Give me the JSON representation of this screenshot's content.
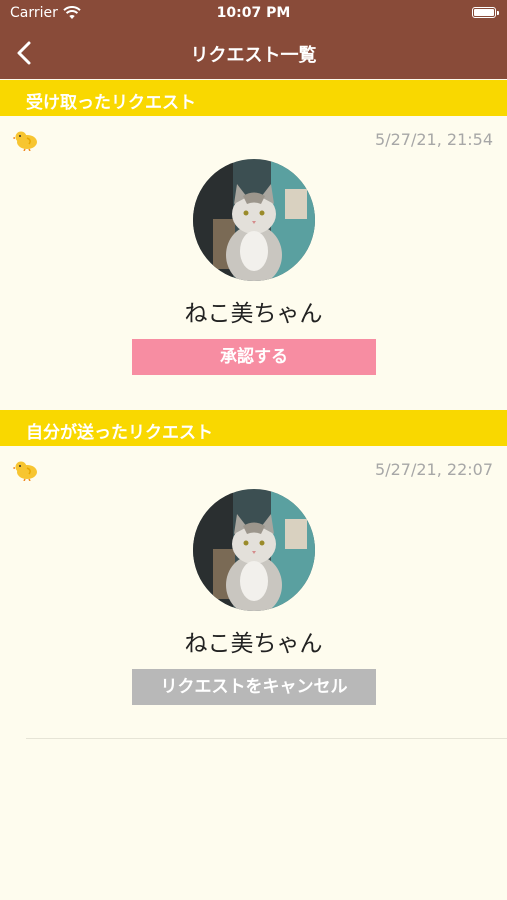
{
  "status_bar": {
    "carrier": "Carrier",
    "time": "10:07 PM"
  },
  "nav": {
    "title": "リクエスト一覧",
    "back_icon": "chevron-left-icon"
  },
  "received": {
    "header": "受け取ったリクエスト",
    "timestamp": "5/27/21, 21:54",
    "user_name": "ねこ美ちゃん",
    "button_label": "承認する",
    "button_color": "#f78da2"
  },
  "sent": {
    "header": "自分が送ったリクエスト",
    "timestamp": "5/27/21, 22:07",
    "user_name": "ねこ美ちゃん",
    "button_label": "リクエストをキャンセル",
    "button_color": "#b8b8b8"
  },
  "colors": {
    "nav_bg": "#894b39",
    "section_bg": "#f9d800",
    "page_bg": "#fefcee"
  }
}
